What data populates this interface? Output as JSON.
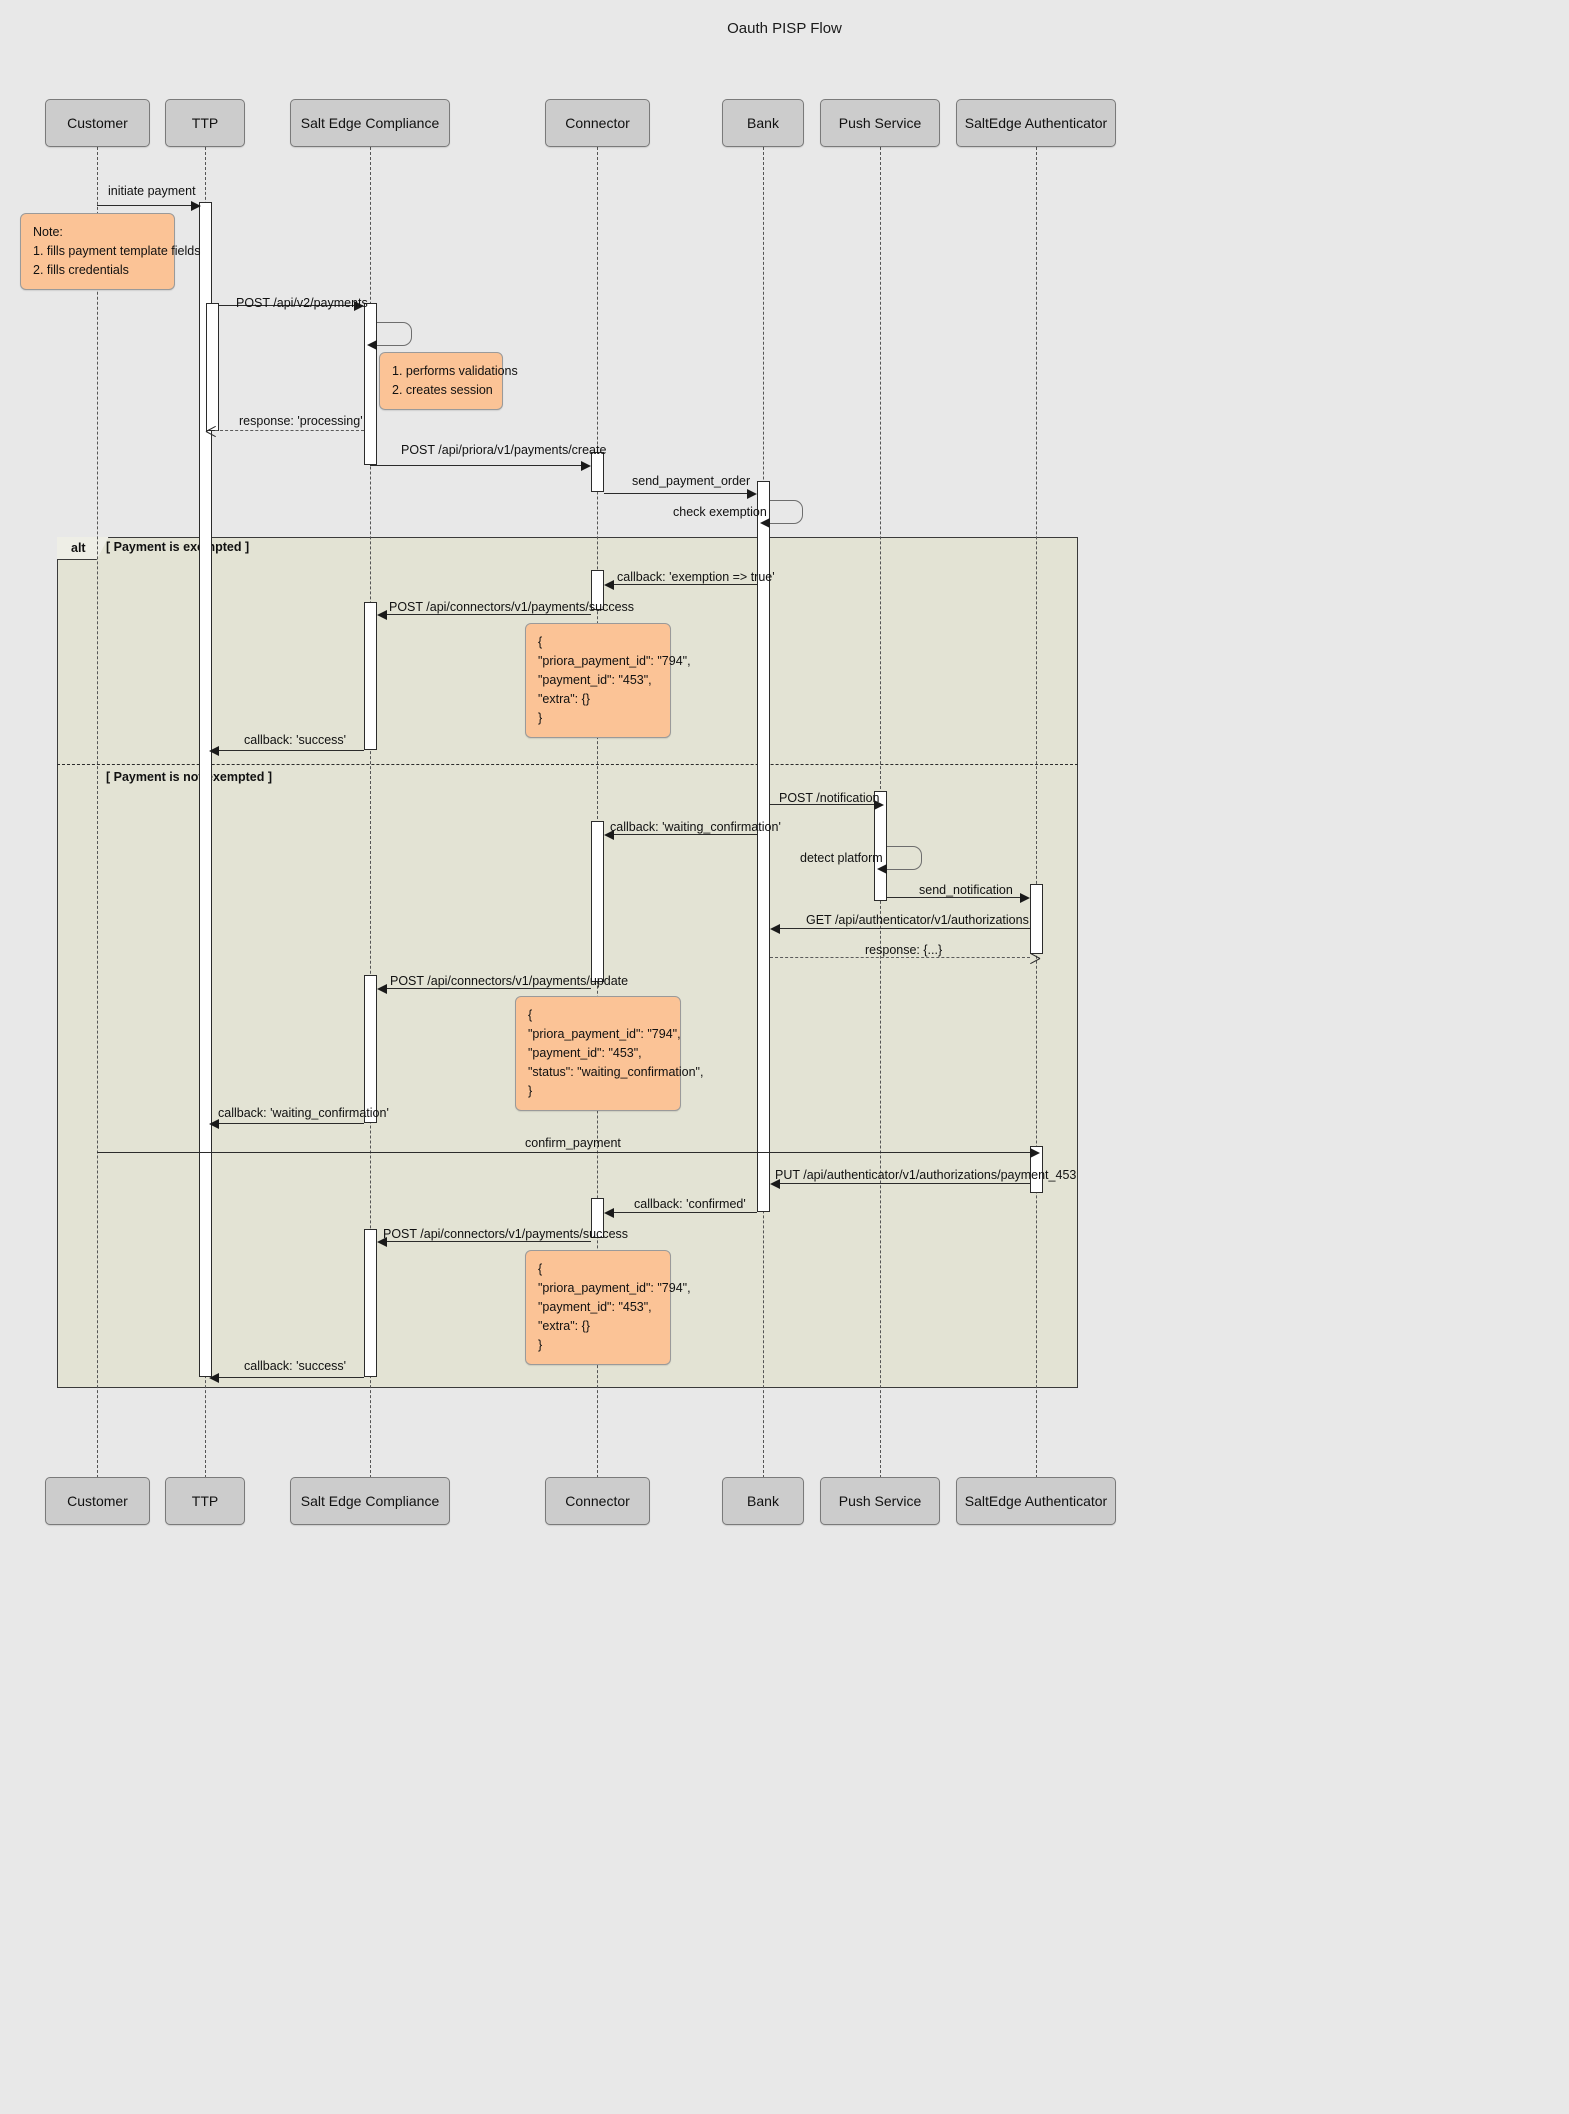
{
  "title": "Oauth PISP Flow",
  "participants": [
    {
      "id": "customer",
      "label": "Customer"
    },
    {
      "id": "ttp",
      "label": "TTP"
    },
    {
      "id": "salt_edge",
      "label": "Salt Edge Compliance"
    },
    {
      "id": "connector",
      "label": "Connector"
    },
    {
      "id": "bank",
      "label": "Bank"
    },
    {
      "id": "push",
      "label": "Push Service"
    },
    {
      "id": "auth",
      "label": "SaltEdge Authenticator"
    }
  ],
  "messages": {
    "initiate_payment": "initiate payment",
    "post_v2_payments": "POST /api/v2/payments",
    "response_processing": "response: 'processing'",
    "post_priora_create": "POST /api/priora/v1/payments/create",
    "send_payment_order": "send_payment_order",
    "check_exemption": "check exemption",
    "callback_exemption_true": "callback: 'exemption => true'",
    "post_connectors_success_1": "POST /api/connectors/v1/payments/success",
    "callback_success_1": "callback: 'success'",
    "post_notification": "POST /notification",
    "callback_waiting_confirmation_1": "callback: 'waiting_confirmation'",
    "detect_platform": "detect platform",
    "send_notification": "send_notification",
    "get_authorizations": "GET  /api/authenticator/v1/authorizations",
    "response_dots": "response: {...}",
    "post_connectors_update": "POST /api/connectors/v1/payments/update",
    "callback_waiting_confirmation_2": "callback: 'waiting_confirmation'",
    "confirm_payment": "confirm_payment",
    "put_authorizations": "PUT /api/authenticator/v1/authorizations/payment_453",
    "callback_confirmed": "callback: 'confirmed'",
    "post_connectors_success_2": "POST /api/connectors/v1/payments/success",
    "callback_success_2": "callback: 'success'"
  },
  "notes": {
    "customer_note": "Note:\n1. fills payment template fields\n2. fills credentials",
    "salt_edge_note": "1. performs validations\n2. creates session",
    "payload_success_1": "{\n\"priora_payment_id\": \"794\",\n\"payment_id\": \"453\",\n\"extra\": {}\n}",
    "payload_update": "{\n\"priora_payment_id\": \"794\",\n\"payment_id\": \"453\",\n\"status\": \"waiting_confirmation\",\n}",
    "payload_success_2": "{\n\"priora_payment_id\": \"794\",\n\"payment_id\": \"453\",\n\"extra\": {}\n}"
  },
  "fragment": {
    "operator": "alt",
    "guard_1": "[ Payment is exempted ]",
    "guard_2": "[ Payment is not exempted ]"
  },
  "colors": {
    "background": "#e8e8e8",
    "actor_fill": "#cccccc",
    "note_fill": "#fbc396",
    "fragment_fill": "#e2e2ce",
    "activation_fill": "#ffffff",
    "line": "#2b2b2b"
  }
}
